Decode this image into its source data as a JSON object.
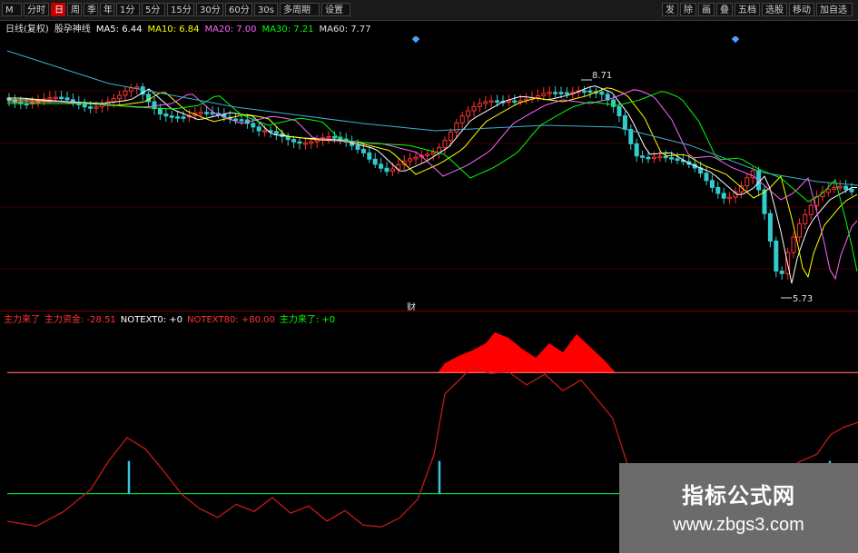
{
  "toolbar": {
    "left_buttons": [
      {
        "label": "M",
        "active": false
      },
      {
        "label": "分时",
        "active": false
      },
      {
        "label": "日",
        "active": true
      },
      {
        "label": "周",
        "active": false
      },
      {
        "label": "季",
        "active": false
      },
      {
        "label": "年",
        "active": false
      },
      {
        "label": "1分",
        "active": false
      },
      {
        "label": "5分",
        "active": false
      },
      {
        "label": "15分",
        "active": false
      },
      {
        "label": "30分",
        "active": false
      },
      {
        "label": "60分",
        "active": false
      },
      {
        "label": "30s",
        "active": false
      },
      {
        "label": "多周期",
        "active": false
      },
      {
        "label": "设置",
        "active": false
      }
    ],
    "right_buttons": [
      "发",
      "除",
      "画",
      "叠",
      "五档",
      "选股",
      "移动",
      "加自选"
    ]
  },
  "price_pane": {
    "indicator_line": [
      {
        "text": "日线(复权)",
        "color": "#e0e0e0"
      },
      {
        "text": "股孕神线",
        "color": "#e0e0e0"
      },
      {
        "text": "MA5: 6.44",
        "color": "#ffffff"
      },
      {
        "text": "MA10: 6.84",
        "color": "#ffff00"
      },
      {
        "text": "MA20: 7.00",
        "color": "#ff66ff"
      },
      {
        "text": "MA30: 7.21",
        "color": "#00ff00"
      },
      {
        "text": "MA60: 7.77",
        "color": "#e0e0e0"
      }
    ],
    "high_label": "8.71",
    "low_label": "5.73",
    "pane_marker": "财",
    "colors": {
      "up": "#ff3333",
      "down": "#33cccc"
    }
  },
  "lower_pane": {
    "legend": [
      {
        "text": "主力来了",
        "color": "#ff3333"
      },
      {
        "text": "主力资金: -28.51",
        "color": "#ff3333"
      },
      {
        "text": "NOTEXT0: +0",
        "color": "#ffffff"
      },
      {
        "text": "NOTEXT80: +80.00",
        "color": "#ff3333"
      },
      {
        "text": "主力来了: +0",
        "color": "#00ff00"
      }
    ],
    "level_80": 80,
    "level_20": 20
  },
  "watermark": {
    "title": "指标公式网",
    "url": "www.zbgs3.com"
  }
}
